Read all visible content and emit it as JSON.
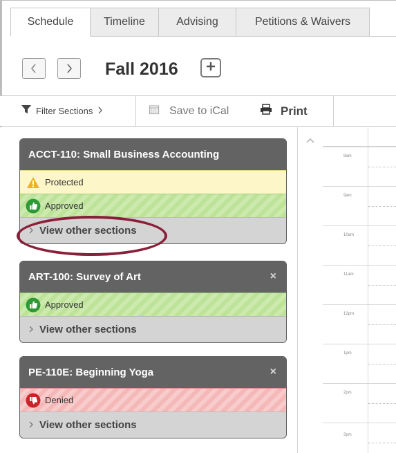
{
  "tabs": [
    {
      "label": "Schedule",
      "active": true
    },
    {
      "label": "Timeline",
      "active": false
    },
    {
      "label": "Advising",
      "active": false
    },
    {
      "label": "Petitions & Waivers",
      "active": false
    }
  ],
  "term": {
    "title": "Fall 2016",
    "prev_icon": "chevron-left-icon",
    "next_icon": "chevron-right-icon",
    "add_icon": "plus-icon"
  },
  "toolbar": {
    "filter_label": "Filter Sections",
    "ical_label": "Save to iCal",
    "print_label": "Print"
  },
  "courses": [
    {
      "title": "ACCT-110: Small Business Accounting",
      "removable": false,
      "statuses": [
        {
          "kind": "protected",
          "label": "Protected",
          "icon": "warning-icon"
        },
        {
          "kind": "approved",
          "label": "Approved",
          "icon": "thumbs-up-icon"
        }
      ],
      "view_other": "View other sections"
    },
    {
      "title": "ART-100: Survey of Art",
      "removable": true,
      "statuses": [
        {
          "kind": "approved",
          "label": "Approved",
          "icon": "thumbs-up-icon"
        }
      ],
      "view_other": "View other sections"
    },
    {
      "title": "PE-110E: Beginning Yoga",
      "removable": true,
      "statuses": [
        {
          "kind": "denied",
          "label": "Denied",
          "icon": "thumbs-down-icon"
        }
      ],
      "view_other": "View other sections"
    }
  ],
  "remove_glyph": "×",
  "calendar": {
    "hours": [
      "8am",
      "9am",
      "10am",
      "11am",
      "12pm",
      "1pm",
      "2pm",
      "3pm"
    ]
  },
  "colors": {
    "course_header": "#636363",
    "protected": "#fdf6c9",
    "approved": "#bde39a",
    "denied": "#f4b8b8",
    "highlight": "#8a1f3a"
  }
}
